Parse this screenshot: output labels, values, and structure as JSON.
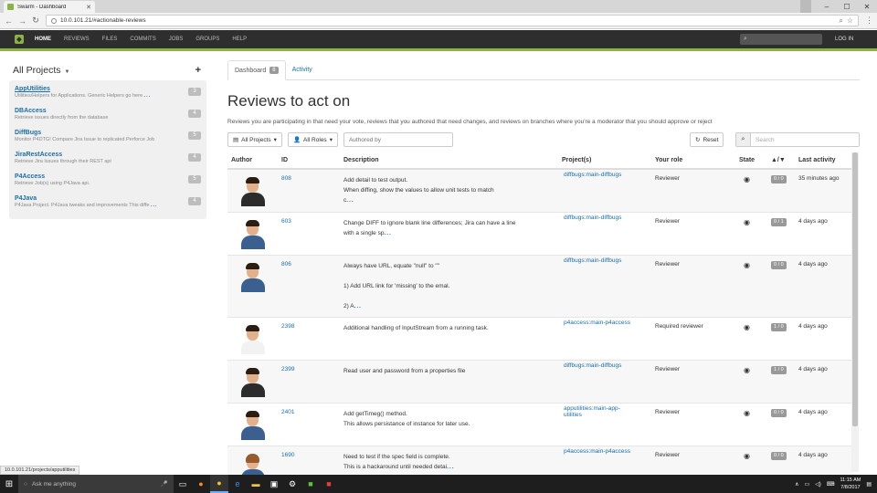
{
  "browser": {
    "tab_title": "Swarm - Dashboard",
    "url": "10.0.101.21/#actionable-reviews"
  },
  "nav": {
    "items": [
      "HOME",
      "REVIEWS",
      "FILES",
      "COMMITS",
      "JOBS",
      "GROUPS",
      "HELP"
    ],
    "login": "LOG IN"
  },
  "sidebar": {
    "title": "All Projects",
    "projects": [
      {
        "name": "AppUtilities",
        "desc": "Utilities/Helpers for Applications.   Generic Helpers go here",
        "count": "3"
      },
      {
        "name": "DBAccess",
        "desc": "Retrieve issues directly from the database",
        "count": "4"
      },
      {
        "name": "DiffBugs",
        "desc": "Monitor P4DTG!  Compare Jira Issue to replicated Perforce Job",
        "count": "5"
      },
      {
        "name": "JiraRestAccess",
        "desc": "Retrieve Jira Issues through their REST api",
        "count": "4"
      },
      {
        "name": "P4Access",
        "desc": "Retrieve Job(s) using P4Java api.",
        "count": "5"
      },
      {
        "name": "P4Java",
        "desc": "P4Java Project.  P4Java tweaks and improvements This diffe",
        "count": "4"
      }
    ]
  },
  "main": {
    "tabs": [
      {
        "label": "Dashboard",
        "badge": "8"
      },
      {
        "label": "Activity"
      }
    ],
    "title": "Reviews to act on",
    "intro": "Reviews you are participating in that need your vote, reviews that you authored that need changes, and reviews on branches where you're a moderator that you should approve or reject",
    "filters": {
      "projects": "All Projects",
      "roles": "All Roles",
      "authored_by_placeholder": "Authored by",
      "reset": "Reset",
      "search_placeholder": "Search"
    },
    "columns": [
      "Author",
      "ID",
      "Description",
      "Project(s)",
      "Your role",
      "State",
      "",
      "Last activity"
    ],
    "vote_header_icon": "up-down-arrow-icon",
    "rows": [
      {
        "id": "808",
        "desc": [
          "Add detail to test output.",
          "When diffing, show the values to allow unit tests to match",
          "c"
        ],
        "project": "diffbugs:main-diffbugs",
        "role": "Reviewer",
        "votes": "0 / 0",
        "activity": "35 minutes ago",
        "avatar": "d"
      },
      {
        "id": "603",
        "desc": [
          "Change DIFF to ignore blank line differences;  Jira can have a line",
          "with a single sp"
        ],
        "project": "diffbugs:main-diffbugs",
        "role": "Reviewer",
        "votes": "0 / 1",
        "activity": "4 days ago",
        "avatar": "b"
      },
      {
        "id": "806",
        "desc": [
          "Always have URL, equate \"null\" to \"\"",
          "",
          "1) Add URL link for 'missing' to the emal.",
          "",
          "2) A"
        ],
        "project": "diffbugs:main-diffbugs",
        "role": "Reviewer",
        "votes": "0 / 0",
        "activity": "4 days ago",
        "avatar": "b"
      },
      {
        "id": "2398",
        "desc": [
          "Additional handling of InputStream from a running task."
        ],
        "project": "p4access:main-p4access",
        "role": "Required reviewer",
        "votes": "1 / 0",
        "activity": "4 days ago",
        "avatar": "w"
      },
      {
        "id": "2399",
        "desc": [
          "Read user and password from a properties file"
        ],
        "project": "diffbugs:main-diffbugs",
        "role": "Reviewer",
        "votes": "1 / 0",
        "activity": "4 days ago",
        "avatar": "d"
      },
      {
        "id": "2401",
        "desc": [
          "Add getTimeg() method.",
          " This allows persistance of instance for later use."
        ],
        "project": "apputilities:main-app-utilities",
        "role": "Reviewer",
        "votes": "0 / 0",
        "activity": "4 days ago",
        "avatar": "b"
      },
      {
        "id": "1690",
        "desc": [
          "Need to test if the spec field is complete.",
          "This is a hackaround until needed detai"
        ],
        "project": "p4access:main-p4access",
        "role": "Reviewer",
        "votes": "0 / 0",
        "activity": "4 days ago",
        "avatar": "f"
      }
    ]
  },
  "status_url": "10.0.101.21/projects/apputilities",
  "taskbar": {
    "search_placeholder": "Ask me anything",
    "time": "11:15 AM",
    "date": "7/8/2017"
  }
}
